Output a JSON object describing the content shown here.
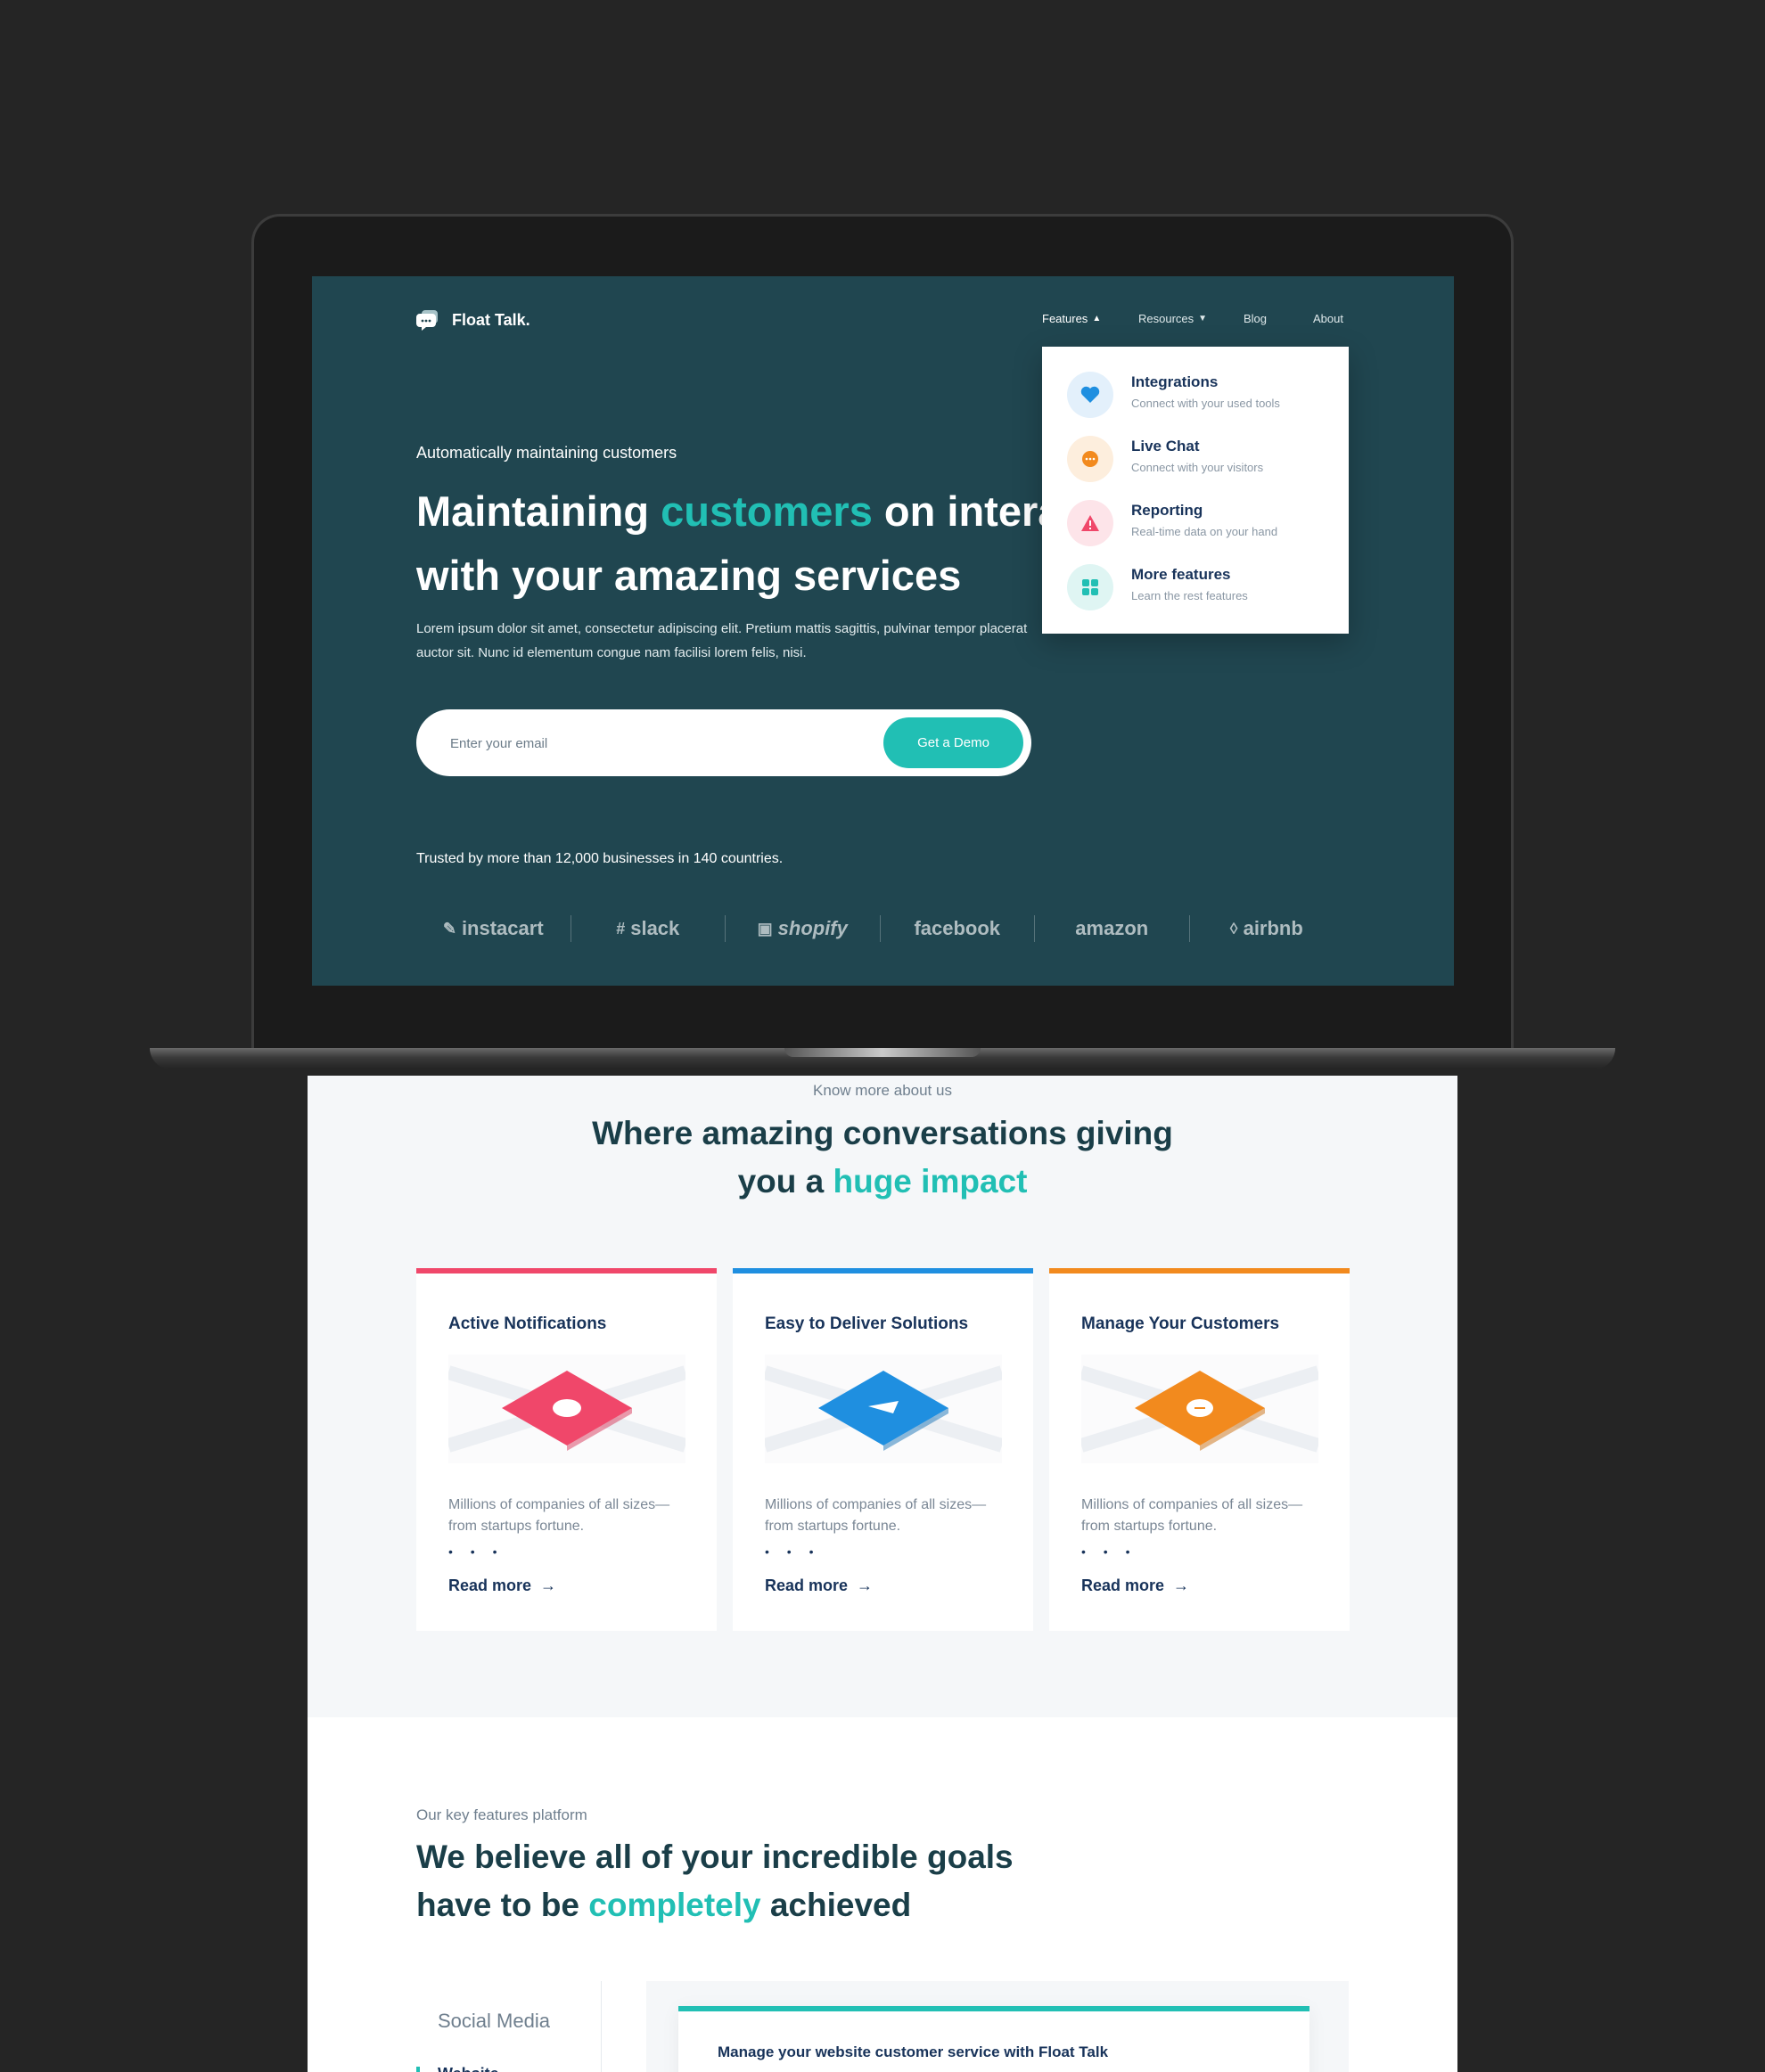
{
  "app": {
    "brand": "Float Talk.",
    "nav": {
      "features": "Features",
      "resources": "Resources",
      "blog": "Blog",
      "about": "About"
    }
  },
  "dropdown": {
    "items": [
      {
        "title": "Integrations",
        "subtitle": "Connect with your used tools",
        "icon": "heart-icon",
        "color": "#1f8fe0"
      },
      {
        "title": "Live Chat",
        "subtitle": "Connect with your visitors",
        "icon": "chat-icon",
        "color": "#f28a1e"
      },
      {
        "title": "Reporting",
        "subtitle": "Real-time data on your hand",
        "icon": "warning-icon",
        "color": "#f0476a"
      },
      {
        "title": "More features",
        "subtitle": "Learn the rest features",
        "icon": "grid-icon",
        "color": "#21bfb4"
      }
    ]
  },
  "hero": {
    "kicker": "Automatically maintaining customers",
    "title_part1": "Maintaining ",
    "title_accent": "customers",
    "title_part2": " on interactions",
    "title_line2": "with your amazing services",
    "description": "Lorem ipsum dolor sit amet, consectetur adipiscing elit. Pretium mattis sagittis, pulvinar tempor placerat auctor sit. Nunc id elementum congue nam facilisi lorem felis, nisi.",
    "email_placeholder": "Enter your email",
    "cta": "Get a Demo",
    "trusted": "Trusted by more than 12,000 businesses in 140 countries.",
    "brands": [
      "instacart",
      "slack",
      "shopify",
      "facebook",
      "amazon",
      "airbnb"
    ]
  },
  "about": {
    "kicker": "Know more about us",
    "title_line1": "Where amazing conversations giving",
    "title_line2_prefix": "you a ",
    "title_accent": "huge impact",
    "cards": [
      {
        "title": "Active Notifications",
        "text": "Millions of companies of all sizes—from startups fortune.",
        "dots": "• • •",
        "link": "Read more",
        "color": "#f0476a"
      },
      {
        "title": "Easy to Deliver Solutions",
        "text": "Millions of companies of all sizes—from startups fortune.",
        "dots": "• • •",
        "link": "Read more",
        "color": "#1f8fe0"
      },
      {
        "title": "Manage Your Customers",
        "text": "Millions of companies of all sizes—from startups fortune.",
        "dots": "• • •",
        "link": "Read more",
        "color": "#f28a1e"
      }
    ]
  },
  "features": {
    "kicker": "Our key features platform",
    "title_line1": "We believe all of your incredible goals",
    "title_line2_prefix": "have to be ",
    "title_accent": "completely",
    "title_line2_suffix": " achieved",
    "side_item": "Social Media",
    "side_sub": "Website",
    "panel_title": "Manage your website customer service with Float Talk"
  },
  "colors": {
    "accent": "#21bfb4",
    "hero_bg": "#204650",
    "navy": "#18335a"
  }
}
